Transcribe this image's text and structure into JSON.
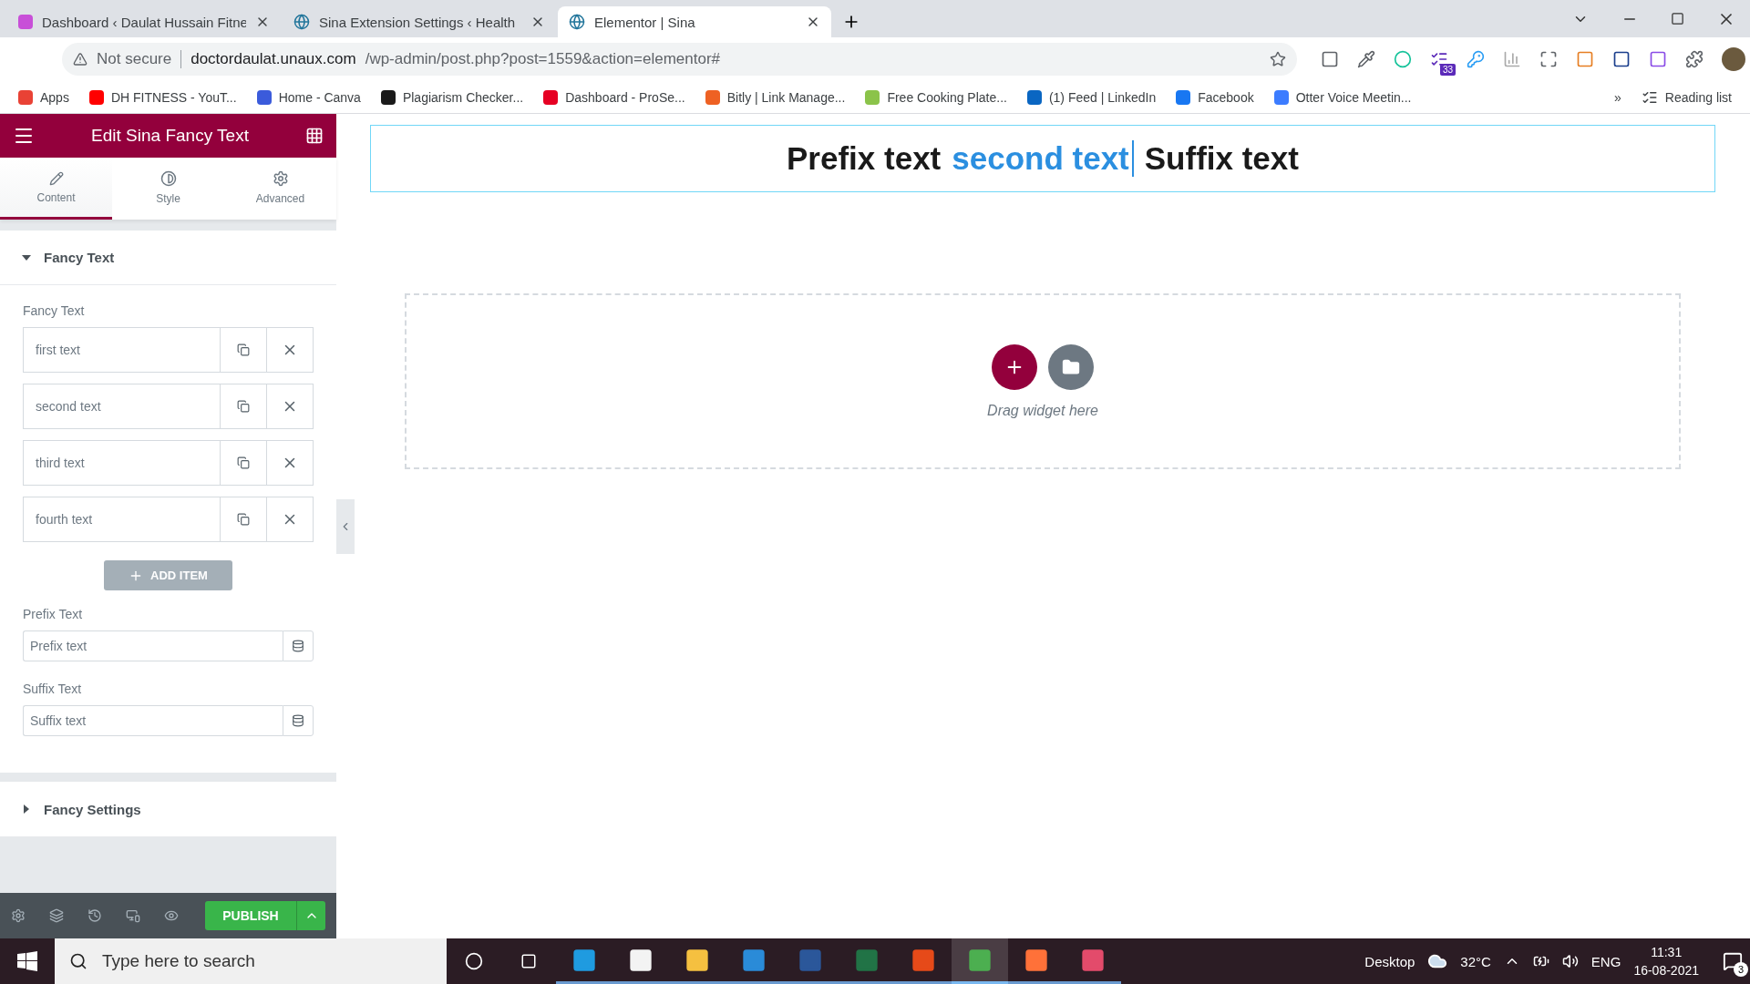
{
  "browser": {
    "tabs": [
      {
        "title": "Dashboard ‹ Daulat Hussain Fitne",
        "selected": false,
        "kind": "hex"
      },
      {
        "title": "Sina Extension Settings ‹ Health",
        "selected": false,
        "kind": "wp"
      },
      {
        "title": "Elementor | Sina",
        "selected": true,
        "kind": "wp"
      }
    ],
    "security": "Not secure",
    "url_host": "doctordaulat.unaux.com",
    "url_path": "/wp-admin/post.php?post=1559&action=elementor#",
    "extension_badge": "33",
    "bookmarks": [
      {
        "label": "Apps",
        "color": "#e94235"
      },
      {
        "label": "DH FITNESS - YouT...",
        "color": "#ff0000"
      },
      {
        "label": "Home - Canva",
        "color": "#3b5bdb"
      },
      {
        "label": "Plagiarism Checker...",
        "color": "#1a1a1a"
      },
      {
        "label": "Dashboard - ProSe...",
        "color": "#e60023"
      },
      {
        "label": "Bitly | Link Manage...",
        "color": "#ee6123"
      },
      {
        "label": "Free Cooking Plate...",
        "color": "#8bc34a"
      },
      {
        "label": "(1) Feed | LinkedIn",
        "color": "#0a66c2"
      },
      {
        "label": "Facebook",
        "color": "#1877f2"
      },
      {
        "label": "Otter Voice Meetin...",
        "color": "#3c7cff"
      }
    ],
    "more": "»",
    "reading_list": "Reading list"
  },
  "panel": {
    "title": "Edit Sina Fancy Text",
    "tabs": [
      {
        "label": "Content",
        "selected": true,
        "kind": "pencil"
      },
      {
        "label": "Style",
        "selected": false,
        "kind": "contrast"
      },
      {
        "label": "Advanced",
        "selected": false,
        "kind": "gear"
      }
    ],
    "sections": [
      {
        "title": "Fancy Text",
        "expanded": true
      },
      {
        "title": "Fancy Settings",
        "expanded": false
      }
    ],
    "fancy_label": "Fancy Text",
    "items": [
      "first text",
      "second text",
      "third text",
      "fourth text"
    ],
    "add_item": "ADD ITEM",
    "fields": [
      {
        "label": "Prefix Text",
        "value": "Prefix text"
      },
      {
        "label": "Suffix Text",
        "value": "Suffix text"
      }
    ],
    "publish": "PUBLISH"
  },
  "preview": {
    "prefix": "Prefix text",
    "fancy": "second text",
    "suffix": "Suffix text",
    "drop_hint": "Drag widget here"
  },
  "taskbar": {
    "search_placeholder": "Type here to search",
    "apps": [
      {
        "kind": "edge",
        "selected": false
      },
      {
        "kind": "store",
        "selected": false
      },
      {
        "kind": "files",
        "selected": false
      },
      {
        "kind": "mail",
        "selected": false
      },
      {
        "kind": "word",
        "selected": false
      },
      {
        "kind": "excel",
        "selected": false
      },
      {
        "kind": "office",
        "selected": false
      },
      {
        "kind": "chrome",
        "selected": true
      },
      {
        "kind": "firefox",
        "selected": false
      },
      {
        "kind": "snip",
        "selected": false
      }
    ],
    "desktop": "Desktop",
    "temperature": "32°C",
    "language": "ENG",
    "time": "11:31",
    "date": "16-08-2021",
    "notifications": "3"
  }
}
